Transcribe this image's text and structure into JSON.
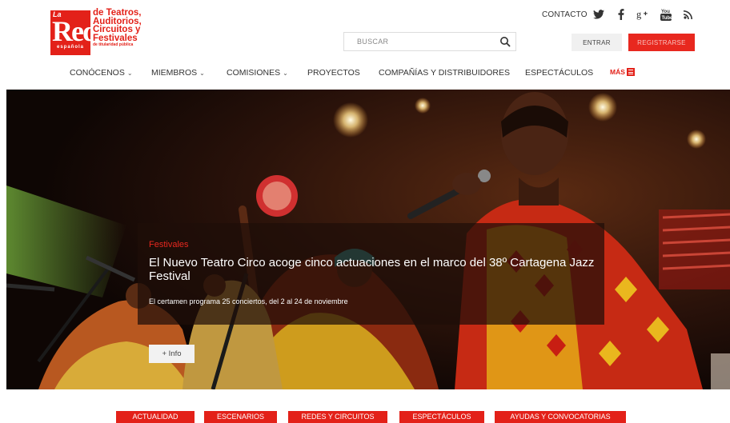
{
  "logo": {
    "la": "La",
    "red": "Red",
    "espanola": "española",
    "lines": [
      "de Teatros,",
      "Auditorios,",
      "Circuitos y",
      "Festivales"
    ],
    "tagline": "de titularidad pública"
  },
  "header": {
    "contacto": "CONTACTO",
    "social_icons": [
      "twitter-icon",
      "facebook-icon",
      "google-plus-icon",
      "youtube-icon",
      "rss-icon"
    ],
    "search_placeholder": "BUSCAR",
    "login_label": "ENTRAR",
    "register_label": "REGISTRARSE"
  },
  "nav": {
    "items": [
      {
        "label": "CONÓCENOS",
        "dropdown": true
      },
      {
        "label": "MIEMBROS",
        "dropdown": true
      },
      {
        "label": "COMISIONES",
        "dropdown": true
      },
      {
        "label": "PROYECTOS",
        "dropdown": false
      },
      {
        "label": "COMPAÑÍAS Y DISTRIBUIDORES",
        "dropdown": false
      },
      {
        "label": "ESPECTÁCULOS",
        "dropdown": false
      }
    ],
    "more_label": "MÁS"
  },
  "hero": {
    "category": "Festivales",
    "title": "El Nuevo Teatro Circo acoge cinco actuaciones en el marco del 38º Cartagena Jazz Festival",
    "subtitle": "El certamen programa 25 conciertos, del 2 al 24 de noviembre",
    "info_button": "+ Info"
  },
  "tabs": [
    "ACTUALIDAD",
    "ESCENARIOS",
    "REDES Y CIRCUITOS",
    "ESPECTÁCULOS",
    "AYUDAS Y CONVOCATORIAS"
  ],
  "colors": {
    "brand_red": "#e32119"
  }
}
